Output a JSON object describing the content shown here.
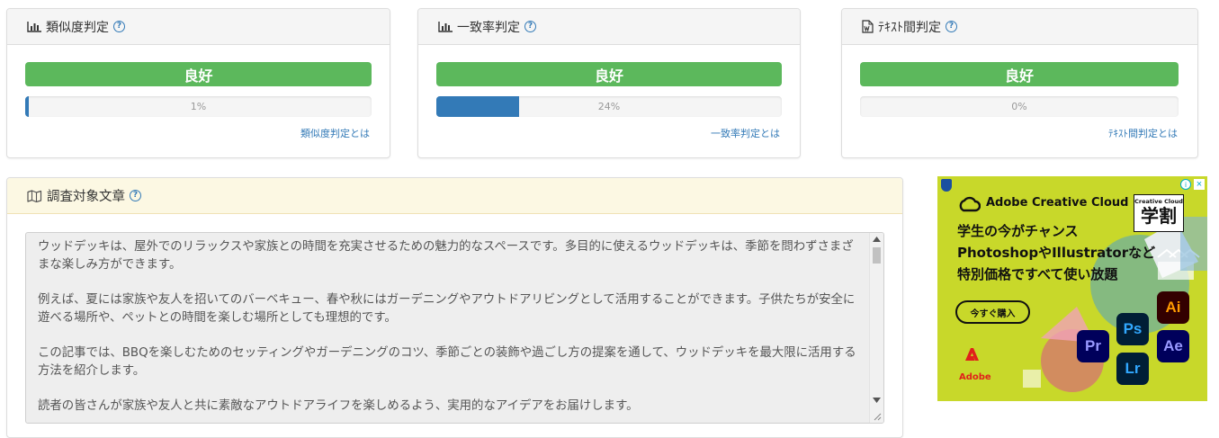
{
  "cards": [
    {
      "title": "類似度判定",
      "status": "良好",
      "percent_label": "1%",
      "fill_fraction": 0.01,
      "link": "類似度判定とは",
      "icon": "bar-chart-icon"
    },
    {
      "title": "一致率判定",
      "status": "良好",
      "percent_label": "24%",
      "fill_fraction": 0.24,
      "link": "一致率判定とは",
      "icon": "bar-chart-icon"
    },
    {
      "title": "ﾃｷｽﾄ間判定",
      "status": "良好",
      "percent_label": "0%",
      "fill_fraction": 0.0,
      "link": "ﾃｷｽﾄ間判定とは",
      "icon": "word-document-icon"
    }
  ],
  "text_panel": {
    "title": "調査対象文章",
    "icon": "map-icon",
    "paragraphs": [
      "ウッドデッキは、屋外でのリラックスや家族との時間を充実させるための魅力的なスペースです。多目的に使えるウッドデッキは、季節を問わずさまざまな楽しみ方ができます。",
      "例えば、夏には家族や友人を招いてのバーベキュー、春や秋にはガーデニングやアウトドアリビングとして活用することができます。子供たちが安全に遊べる場所や、ペットとの時間を楽しむ場所としても理想的です。",
      "この記事では、BBQを楽しむためのセッティングやガーデニングのコツ、季節ごとの装飾や過ごし方の提案を通して、ウッドデッキを最大限に活用する方法を紹介します。",
      "読者の皆さんが家族や友人と共に素敵なアウトドアライフを楽しめるよう、実用的なアイデアをお届けします。"
    ]
  },
  "ad": {
    "brand": "Adobe Creative Cloud",
    "badge_top": "Creative Cloud",
    "badge_main": "学割",
    "line1": "学生の今がチャンス",
    "line2": "PhotoshopやIllustratorなど",
    "line3": "特別価格ですべて使い放題",
    "cta": "今すぐ購入",
    "adobe_label": "Adobe",
    "apps": {
      "ai": "Ai",
      "ps": "Ps",
      "pr": "Pr",
      "ae": "Ae",
      "lr": "Lr"
    },
    "colors": {
      "background": "#c8d82a",
      "app_bg": "#001e36"
    }
  },
  "colors": {
    "success": "#5cb85c",
    "primary": "#337ab7"
  }
}
